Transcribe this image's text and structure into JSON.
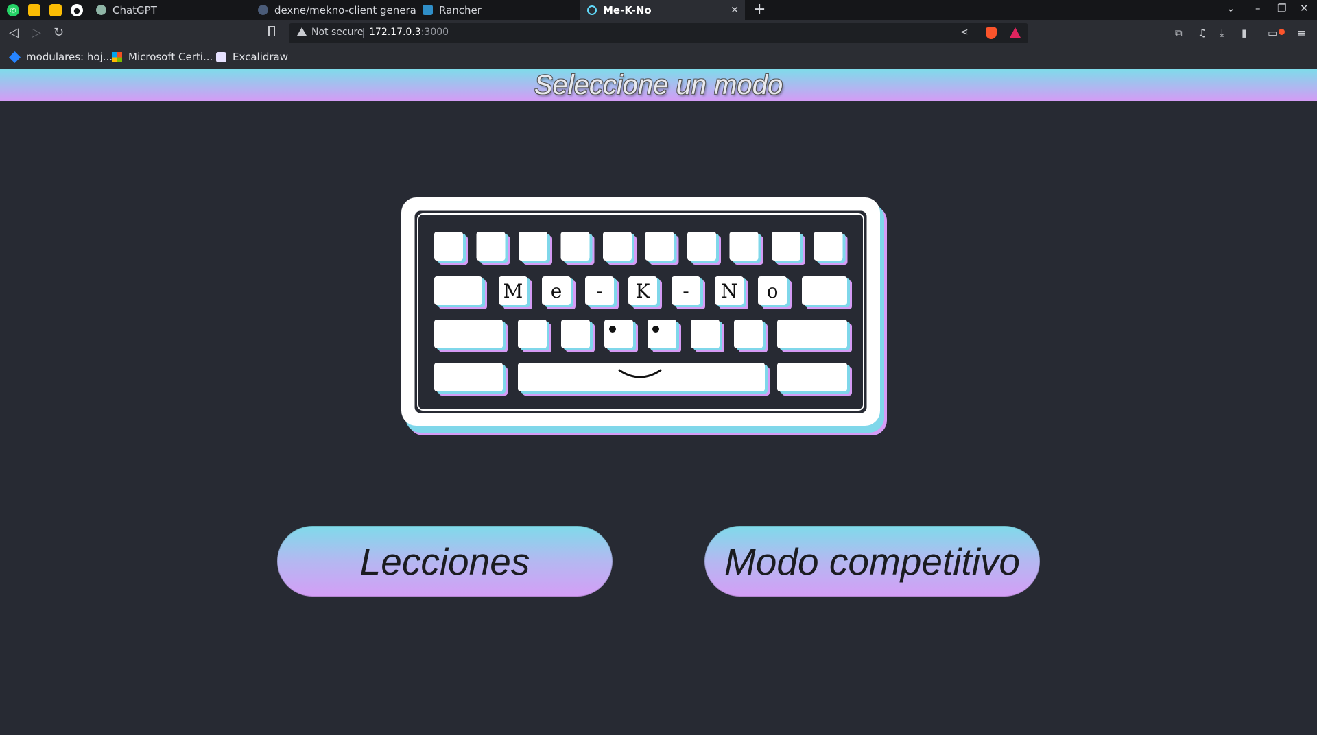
{
  "browser": {
    "pinned_tabs": [
      {
        "icon": "whatsapp-icon",
        "color": "#25d366"
      },
      {
        "icon": "keep-notes-icon",
        "color": "#fbbc04"
      },
      {
        "icon": "photos-icon",
        "color": "#fbbc04"
      },
      {
        "icon": "github-icon",
        "color": "#ffffff"
      }
    ],
    "tabs": [
      {
        "title": "ChatGPT",
        "icon": "chatgpt-icon",
        "active": false
      },
      {
        "title": "dexne/mekno-client general |",
        "icon": "chat-icon",
        "active": false
      },
      {
        "title": "Rancher",
        "icon": "rancher-icon",
        "active": false
      },
      {
        "title": "Me-K-No",
        "icon": "react-icon",
        "active": true
      }
    ],
    "url": {
      "security_label": "Not secure",
      "host": "172.17.0.3",
      "port": ":3000"
    },
    "bookmarks": [
      {
        "label": "modulares: hoj...",
        "icon": "jira-icon"
      },
      {
        "label": "Microsoft Certi...",
        "icon": "microsoft-icon"
      },
      {
        "label": "Excalidraw",
        "icon": "excalidraw-icon"
      }
    ]
  },
  "page": {
    "header": {
      "title": "Seleccione un modo"
    },
    "logo": {
      "letters": [
        "M",
        "e",
        "-",
        "K",
        "-",
        "N",
        "o"
      ]
    },
    "buttons": {
      "lessons_label": "Lecciones",
      "competitive_label": "Modo competitivo"
    },
    "colors": {
      "background": "#272a33",
      "gradient_top": "#7fdbea",
      "gradient_bottom": "#d59bf5",
      "key_shadow_blue": "#7fd7ea",
      "key_shadow_pink": "#d59bf5"
    }
  }
}
